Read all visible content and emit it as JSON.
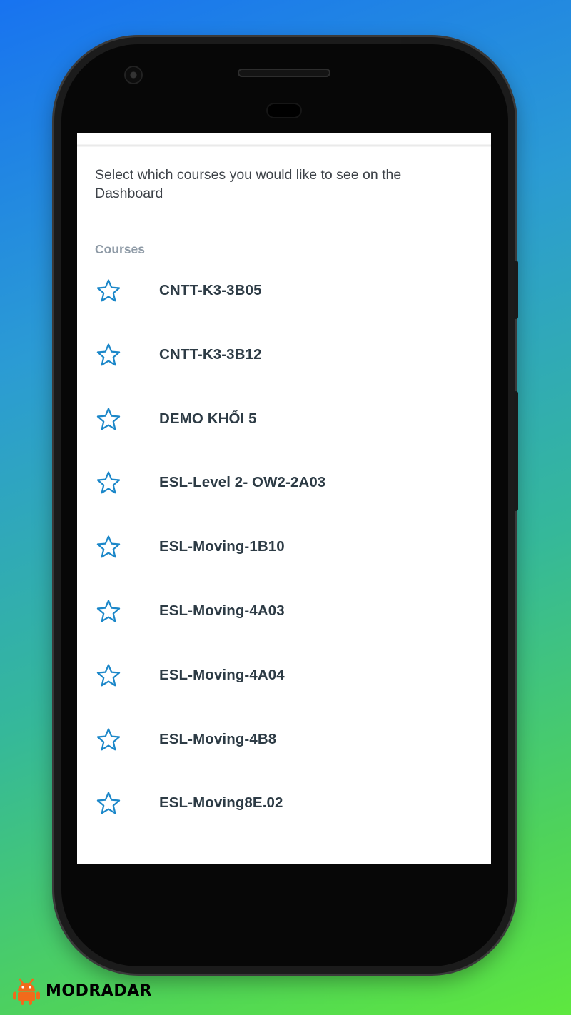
{
  "screen": {
    "intro_text": "Select which courses you would like to see on the Dashboard",
    "section_header": "Courses",
    "courses": [
      {
        "name": "CNTT-K3-3B05",
        "icon": "star-outline-icon"
      },
      {
        "name": "CNTT-K3-3B12",
        "icon": "star-outline-icon"
      },
      {
        "name": "DEMO KHỐI 5",
        "icon": "star-outline-icon"
      },
      {
        "name": "ESL-Level 2- OW2-2A03",
        "icon": "star-outline-icon"
      },
      {
        "name": "ESL-Moving-1B10",
        "icon": "star-outline-icon"
      },
      {
        "name": "ESL-Moving-4A03",
        "icon": "star-outline-icon"
      },
      {
        "name": "ESL-Moving-4A04",
        "icon": "star-outline-icon"
      },
      {
        "name": "ESL-Moving-4B8",
        "icon": "star-outline-icon"
      },
      {
        "name": "ESL-Moving8E.02",
        "icon": "star-outline-icon"
      }
    ]
  },
  "watermark": {
    "brand": "MODRADAR",
    "icon": "android-robot-icon"
  },
  "colors": {
    "accent": "#1b87c9",
    "course_text": "#2d3b45",
    "header_text": "#8e9aa6"
  }
}
